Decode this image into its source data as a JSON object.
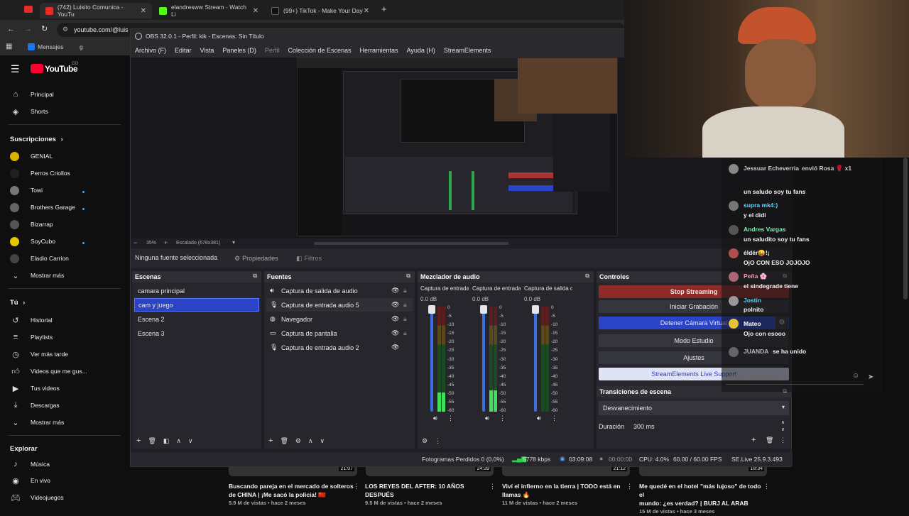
{
  "browser": {
    "tabs": [
      {
        "label": "(742) Luisito Comunica - YouTu"
      },
      {
        "label": "elandresww Stream - Watch Li"
      },
      {
        "label": "(99+) TikTok - Make Your Day"
      }
    ],
    "address": "youtube.com/@luis",
    "bookmarks": [
      {
        "label": "Mensajes"
      },
      {
        "label": "g"
      }
    ]
  },
  "youtube": {
    "logo": "YouTube",
    "country": "CO",
    "nav": [
      {
        "label": "Principal",
        "icon": "home-icon"
      },
      {
        "label": "Shorts",
        "icon": "shorts-icon"
      }
    ],
    "subs_title": "Suscripciones",
    "subs": [
      {
        "label": "GENIAL",
        "color": "#d9b300",
        "live": false
      },
      {
        "label": "Perros Criollos",
        "color": "#202020",
        "live": false
      },
      {
        "label": "Towi",
        "color": "#777777",
        "live": true
      },
      {
        "label": "Brothers Garage",
        "color": "#666666",
        "live": true
      },
      {
        "label": "Bizarrap",
        "color": "#555555",
        "live": false
      },
      {
        "label": "SoyCubo",
        "color": "#e5c800",
        "live": true
      },
      {
        "label": "Eladio Carrion",
        "color": "#444444",
        "live": false
      }
    ],
    "more_label": "Mostrar más",
    "you_title": "Tú",
    "you_items": [
      {
        "label": "Historial",
        "icon": "history-icon"
      },
      {
        "label": "Playlists",
        "icon": "playlist-icon"
      },
      {
        "label": "Ver más tarde",
        "icon": "clock-icon"
      },
      {
        "label": "Videos que me gus...",
        "icon": "thumbs-up-icon"
      },
      {
        "label": "Tus videos",
        "icon": "video-icon"
      },
      {
        "label": "Descargas",
        "icon": "download-icon"
      },
      {
        "label": "Mostrar más",
        "icon": "chevron-down-icon"
      }
    ],
    "explore_title": "Explorar",
    "explore_items": [
      {
        "label": "Música",
        "icon": "music-icon"
      },
      {
        "label": "En vivo",
        "icon": "live-icon"
      },
      {
        "label": "Videojuegos",
        "icon": "gamepad-icon"
      }
    ],
    "videos": [
      {
        "title1": "Buscando pareja en el mercado de solteros",
        "title2": "de CHINA | ¡Me sacó la policía! 🇨🇳",
        "meta": "5.9 M de vistas • hace 2 meses",
        "duration": "21:07"
      },
      {
        "title1": "LOS REYES DEL AFTER: 10 AÑOS DESPUÉS",
        "title2": "",
        "meta": "9.5 M de vistas • hace 2 meses",
        "duration": "24:39"
      },
      {
        "title1": "Viví el infierno en la tierra | TODO está en",
        "title2": "llamas 🔥",
        "meta": "11 M de vistas • hace 2 meses",
        "duration": "21:12"
      },
      {
        "title1": "Me quedé en el hotel \"más lujoso\" de todo el",
        "title2": "mundo: ¿es verdad? | BURJ AL ARAB",
        "meta": "15 M de vistas • hace 3 meses",
        "duration": "18:34"
      }
    ]
  },
  "obs": {
    "title": "OBS 32.0.1 - Perfil: kik - Escenas: Sin Título",
    "menu": [
      "Archivo (F)",
      "Editar",
      "Vista",
      "Paneles (D)",
      "Perfil",
      "Colección de Escenas",
      "Herramientas",
      "Ayuda (H)",
      "StreamElements"
    ],
    "zoom": "35%",
    "scale": "Escalado (678x381)",
    "no_source": "Ninguna fuente seleccionada",
    "props_label": "Propiedades",
    "filters_label": "Filtros",
    "scenes_title": "Escenas",
    "scenes": [
      "camara principal",
      "cam y juego",
      "Escena 2",
      "Escena 3"
    ],
    "scenes_selected": 1,
    "sources_title": "Fuentes",
    "sources": [
      {
        "label": "Captura de salida de audio",
        "icon": "speaker-icon"
      },
      {
        "label": "Captura de entrada audio 5",
        "icon": "microphone-icon"
      },
      {
        "label": "Navegador",
        "icon": "globe-icon"
      },
      {
        "label": "Captura de pantalla",
        "icon": "monitor-icon"
      },
      {
        "label": "Captura de entrada audio 2",
        "icon": "microphone-icon"
      }
    ],
    "mixer_title": "Mezclador de audio",
    "mixer_channels": [
      {
        "label": "Captura de entrada",
        "db": "0.0 dB",
        "level": 0.18
      },
      {
        "label": "Captura de entrada",
        "db": "0.0 dB",
        "level": 0.2
      },
      {
        "label": "Captura de salida c",
        "db": "0.0 dB",
        "level": 0.0
      }
    ],
    "mixer_ticks": [
      "0",
      "-5",
      "-10",
      "-15",
      "-20",
      "-25",
      "-30",
      "-35",
      "-40",
      "-45",
      "-50",
      "-55",
      "-60"
    ],
    "controls_title": "Controles",
    "controls": [
      {
        "label": "Stop Streaming",
        "style": "stop"
      },
      {
        "label": "Iniciar Grabación",
        "style": "normal"
      },
      {
        "label": "Detener Cámara Virtual",
        "style": "blue"
      },
      {
        "label": "Modo Estudio",
        "style": "normal"
      },
      {
        "label": "Ajustes",
        "style": "normal"
      },
      {
        "label": "StreamElements Live Support",
        "style": "light"
      }
    ],
    "transitions_title": "Transiciones de escena",
    "transition": "Desvanecimiento",
    "duration_label": "Duración",
    "duration_value": "300 ms",
    "status": {
      "dropped": "Fotogramas Perdidos 0 (0.0%)",
      "bitrate": "5778 kbps",
      "stream_time": "03:09:08",
      "rec_time": "00:00:00",
      "cpu": "CPU: 4.0%",
      "fps": "60.00 / 60.00 FPS",
      "se": "SE.Live 25.9.3.493"
    }
  },
  "chat": {
    "messages": [
      {
        "name": "Jessuar Echeverria",
        "text": "",
        "suffix": "envió Rosa 🌹 x1",
        "color": "#cccccc"
      },
      {
        "name": "",
        "text": "un saludo soy tu fans",
        "color": "#cccccc"
      },
      {
        "name": "supra mk4:)",
        "text": "y el didi",
        "color": "#5fd4ff"
      },
      {
        "name": "Andres Vargas",
        "text": "un saludito soy tu fans",
        "color": "#7cf0b0"
      },
      {
        "name": "éldér😜!¡",
        "text": "OjO CON ESO JOJOJO",
        "color": "#f1f1f1"
      },
      {
        "name": "Peña 🌸",
        "text": "el sindegrade tiene",
        "color": "#ff8fb5"
      },
      {
        "name": "Jostin",
        "text": "polnito",
        "color": "#5fd4ff"
      },
      {
        "name": "Mateo",
        "text": "Ojo con esooo",
        "color": "#ffffff"
      },
      {
        "name": "JUANDA",
        "text": "se ha unido",
        "color": "#bbbbbb"
      }
    ],
    "input_placeholder": "Añade comentario..."
  }
}
